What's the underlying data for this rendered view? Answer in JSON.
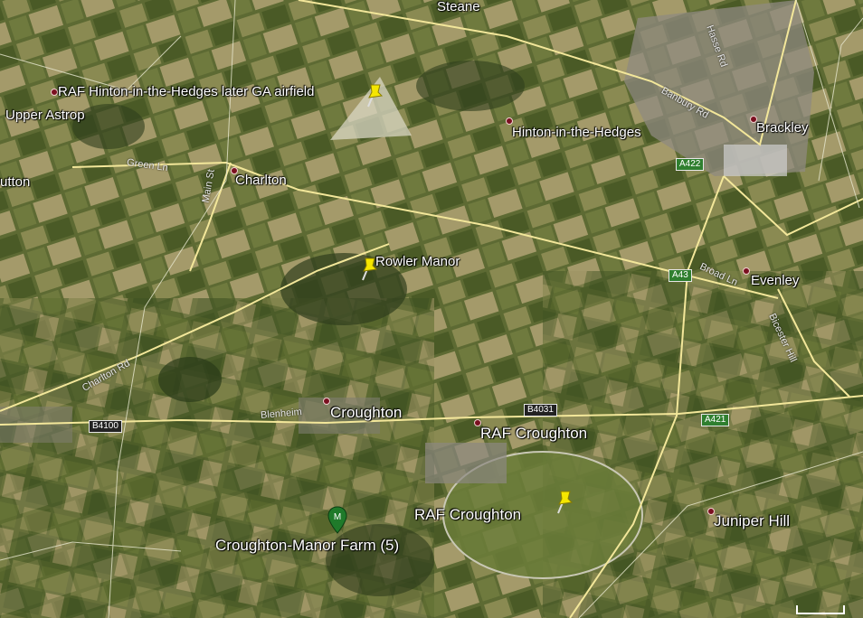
{
  "places": {
    "steane": "Steane",
    "raf_hinton": "RAF Hinton-in-the-Hedges later GA airfield",
    "upper_astrop": "Upper Astrop",
    "hinton": "Hinton-in-the-Hedges",
    "brackley": "Brackley",
    "sutton": "utton",
    "charlton": "Charlton",
    "rowler_manor": "Rowler Manor",
    "evenley": "Evenley",
    "croughton": "Croughton",
    "raf_croughton_village": "RAF Croughton",
    "raf_croughton_airfield": "RAF Croughton",
    "juniper_hill": "Juniper Hill",
    "croughton_manor_farm": "Croughton-Manor Farm (5)"
  },
  "roads": {
    "green_ln": "Green Ln",
    "main_st": "Main St",
    "charlton_rd": "Charlton Rd",
    "blenheim": "Blenheim",
    "banbury_rd": "Banbury Rd",
    "hasse_rd": "Hasse Rd",
    "broad_ln": "Broad Ln",
    "bicester_hill": "Bicester Hill"
  },
  "shields": {
    "a422": "A422",
    "a43": "A43",
    "a421": "A421",
    "b4031": "B4031",
    "b4100": "B4100"
  },
  "colors": {
    "pushpin": "#f5e600",
    "placemark_green": "#1f7a2a",
    "road": "#f3e79a",
    "boundary": "#e8e8d0",
    "dot": "#7a1020"
  }
}
